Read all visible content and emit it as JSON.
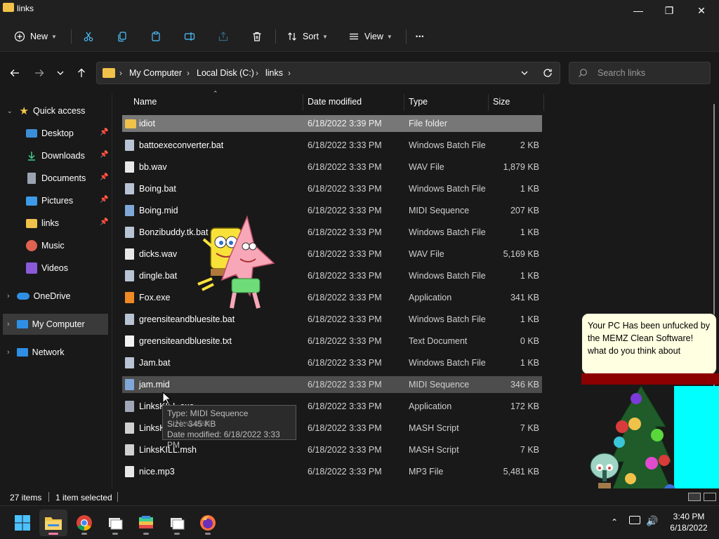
{
  "window": {
    "title": "links",
    "min_glyph": "—",
    "restore_glyph": "❐",
    "close_glyph": "✕"
  },
  "toolbar": {
    "new_label": "New",
    "sort_label": "Sort",
    "view_label": "View",
    "more_glyph": "•••"
  },
  "address": {
    "crumbs": [
      "My Computer",
      "Local Disk (C:)",
      "links"
    ],
    "search_placeholder": "Search links"
  },
  "sidebar": {
    "quick_access": "Quick access",
    "items": [
      {
        "label": "Desktop",
        "icon": "desktop-icon",
        "pinned": true
      },
      {
        "label": "Downloads",
        "icon": "download-icon",
        "pinned": true
      },
      {
        "label": "Documents",
        "icon": "documents-icon",
        "pinned": true
      },
      {
        "label": "Pictures",
        "icon": "pictures-icon",
        "pinned": true
      },
      {
        "label": "links",
        "icon": "folder-icon",
        "pinned": true
      },
      {
        "label": "Music",
        "icon": "music-icon",
        "pinned": false
      },
      {
        "label": "Videos",
        "icon": "videos-icon",
        "pinned": false
      }
    ],
    "onedrive": "OneDrive",
    "my_computer": "My Computer",
    "network": "Network"
  },
  "columns": {
    "name": "Name",
    "date": "Date modified",
    "type": "Type",
    "size": "Size"
  },
  "files": [
    {
      "name": "idiot",
      "date": "6/18/2022 3:39 PM",
      "type": "File folder",
      "size": "",
      "icon": "folder-icon"
    },
    {
      "name": "battoexeconverter.bat",
      "date": "6/18/2022 3:33 PM",
      "type": "Windows Batch File",
      "size": "2 KB",
      "icon": "batch-file-icon"
    },
    {
      "name": "bb.wav",
      "date": "6/18/2022 3:33 PM",
      "type": "WAV File",
      "size": "1,879 KB",
      "icon": "audio-file-icon"
    },
    {
      "name": "Boing.bat",
      "date": "6/18/2022 3:33 PM",
      "type": "Windows Batch File",
      "size": "1 KB",
      "icon": "batch-file-icon"
    },
    {
      "name": "Boing.mid",
      "date": "6/18/2022 3:33 PM",
      "type": "MIDI Sequence",
      "size": "207 KB",
      "icon": "midi-file-icon"
    },
    {
      "name": "Bonzibuddy.tk.bat",
      "date": "6/18/2022 3:33 PM",
      "type": "Windows Batch File",
      "size": "1 KB",
      "icon": "batch-file-icon"
    },
    {
      "name": "dicks.wav",
      "date": "6/18/2022 3:33 PM",
      "type": "WAV File",
      "size": "5,169 KB",
      "icon": "audio-file-icon"
    },
    {
      "name": "dingle.bat",
      "date": "6/18/2022 3:33 PM",
      "type": "Windows Batch File",
      "size": "1 KB",
      "icon": "batch-file-icon"
    },
    {
      "name": "Fox.exe",
      "date": "6/18/2022 3:33 PM",
      "type": "Application",
      "size": "341 KB",
      "icon": "fox-app-icon"
    },
    {
      "name": "greensiteandbluesite.bat",
      "date": "6/18/2022 3:33 PM",
      "type": "Windows Batch File",
      "size": "1 KB",
      "icon": "batch-file-icon"
    },
    {
      "name": "greensiteandbluesite.txt",
      "date": "6/18/2022 3:33 PM",
      "type": "Text Document",
      "size": "0 KB",
      "icon": "text-file-icon"
    },
    {
      "name": "Jam.bat",
      "date": "6/18/2022 3:33 PM",
      "type": "Windows Batch File",
      "size": "1 KB",
      "icon": "batch-file-icon"
    },
    {
      "name": "jam.mid",
      "date": "6/18/2022 3:33 PM",
      "type": "MIDI Sequence",
      "size": "346 KB",
      "icon": "midi-file-icon"
    },
    {
      "name": "LinksKILL.exe",
      "date": "6/18/2022 3:33 PM",
      "type": "Application",
      "size": "172 KB",
      "icon": "app-file-icon"
    },
    {
      "name": "LinksKILL.msh",
      "date": "6/18/2022 3:33 PM",
      "type": "MASH Script",
      "size": "7 KB",
      "icon": "mash-script-icon"
    },
    {
      "name": "LinksKILL.msh",
      "date": "6/18/2022 3:33 PM",
      "type": "MASH Script",
      "size": "7 KB",
      "icon": "mash-script-icon"
    },
    {
      "name": "nice.mp3",
      "date": "6/18/2022 3:33 PM",
      "type": "MP3 File",
      "size": "5,481 KB",
      "icon": "audio-file-icon"
    }
  ],
  "tooltip": {
    "type": "Type: MIDI Sequence",
    "size": "Size: 345 KB",
    "date": "Date modified: 6/18/2022 3:33 PM",
    "extra": "New.msh"
  },
  "status": {
    "items": "27 items",
    "selected": "1 item selected"
  },
  "popup": {
    "message": "Your PC Has been unfucked by the MEMZ Clean Software! what do you think about"
  },
  "clock": {
    "time": "3:40 PM",
    "date": "6/18/2022"
  },
  "colors": {
    "accent": "#4cc2ff",
    "folder": "#f0c24a",
    "selection": "#777777"
  }
}
